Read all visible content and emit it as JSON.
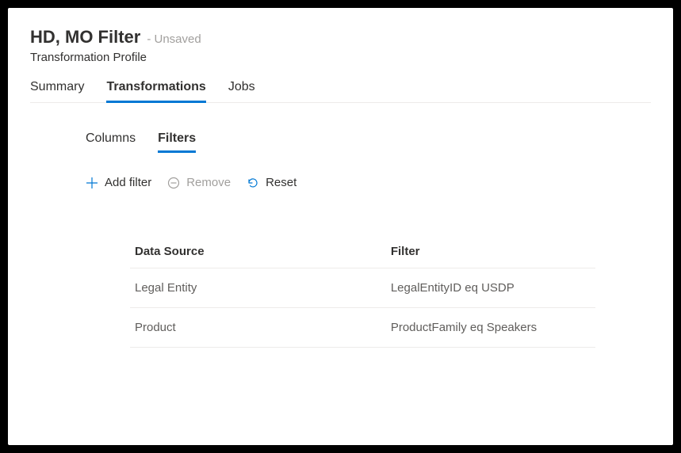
{
  "header": {
    "title": "HD, MO Filter",
    "unsaved_label": "- Unsaved",
    "subtitle": "Transformation Profile"
  },
  "top_tabs": [
    {
      "label": "Summary",
      "active": false
    },
    {
      "label": "Transformations",
      "active": true
    },
    {
      "label": "Jobs",
      "active": false
    }
  ],
  "sub_tabs": [
    {
      "label": "Columns",
      "active": false
    },
    {
      "label": "Filters",
      "active": true
    }
  ],
  "toolbar": {
    "add_filter_label": "Add filter",
    "remove_label": "Remove",
    "reset_label": "Reset"
  },
  "table": {
    "headers": {
      "data_source": "Data Source",
      "filter": "Filter"
    },
    "rows": [
      {
        "data_source": "Legal Entity",
        "filter": "LegalEntityID eq USDP"
      },
      {
        "data_source": "Product",
        "filter": "ProductFamily eq Speakers"
      }
    ]
  }
}
